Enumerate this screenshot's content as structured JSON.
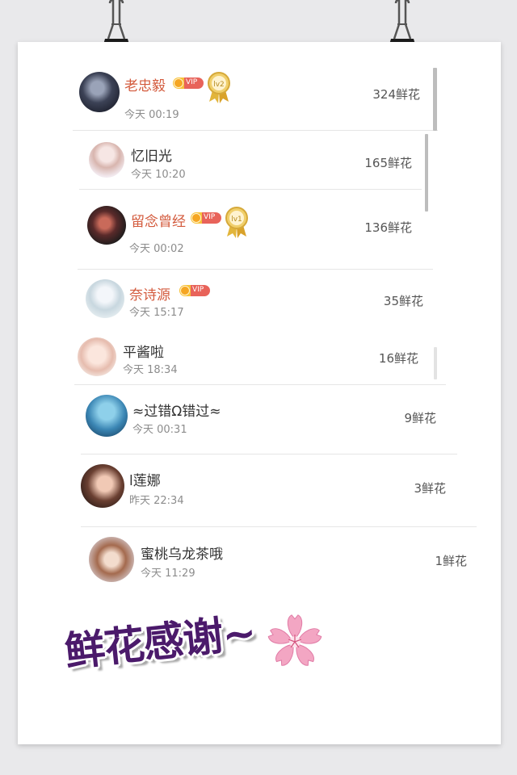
{
  "ranking": [
    {
      "name": "老忠毅",
      "time": "今天 00:19",
      "flowers": "324鲜花",
      "vip": "VIP",
      "medal": "lv2",
      "name_color": "#d35a3c"
    },
    {
      "name": "忆旧光",
      "time": "今天 10:20",
      "flowers": "165鲜花"
    },
    {
      "name": "留念曾经",
      "time": "今天 00:02",
      "flowers": "136鲜花",
      "vip": "VIP",
      "medal": "lv1",
      "name_color": "#d35a3c"
    },
    {
      "name": "奈诗源",
      "time": "今天 15:17",
      "flowers": "35鲜花",
      "vip": "VIP",
      "name_color": "#d35a3c"
    },
    {
      "name": "平酱啦",
      "time": "今天 18:34",
      "flowers": "16鲜花"
    },
    {
      "name": "≈过错Ω错过≈",
      "time": "今天 00:31",
      "flowers": "9鲜花"
    },
    {
      "name": "l莲娜",
      "time": "昨天 22:34",
      "flowers": "3鲜花"
    },
    {
      "name": "蜜桃乌龙茶哦",
      "time": "今天 11:29",
      "flowers": "1鲜花"
    }
  ],
  "caption": "鲜花感谢~",
  "icons": {
    "clip": "binder-clip-icon",
    "flower": "sakura-flower-icon",
    "medal": "level-medal-icon",
    "vip": "vip-badge-icon"
  },
  "colors": {
    "vip_name": "#d35a3c",
    "caption": "#4b1a6b",
    "sakura": "#f3a6c3"
  }
}
